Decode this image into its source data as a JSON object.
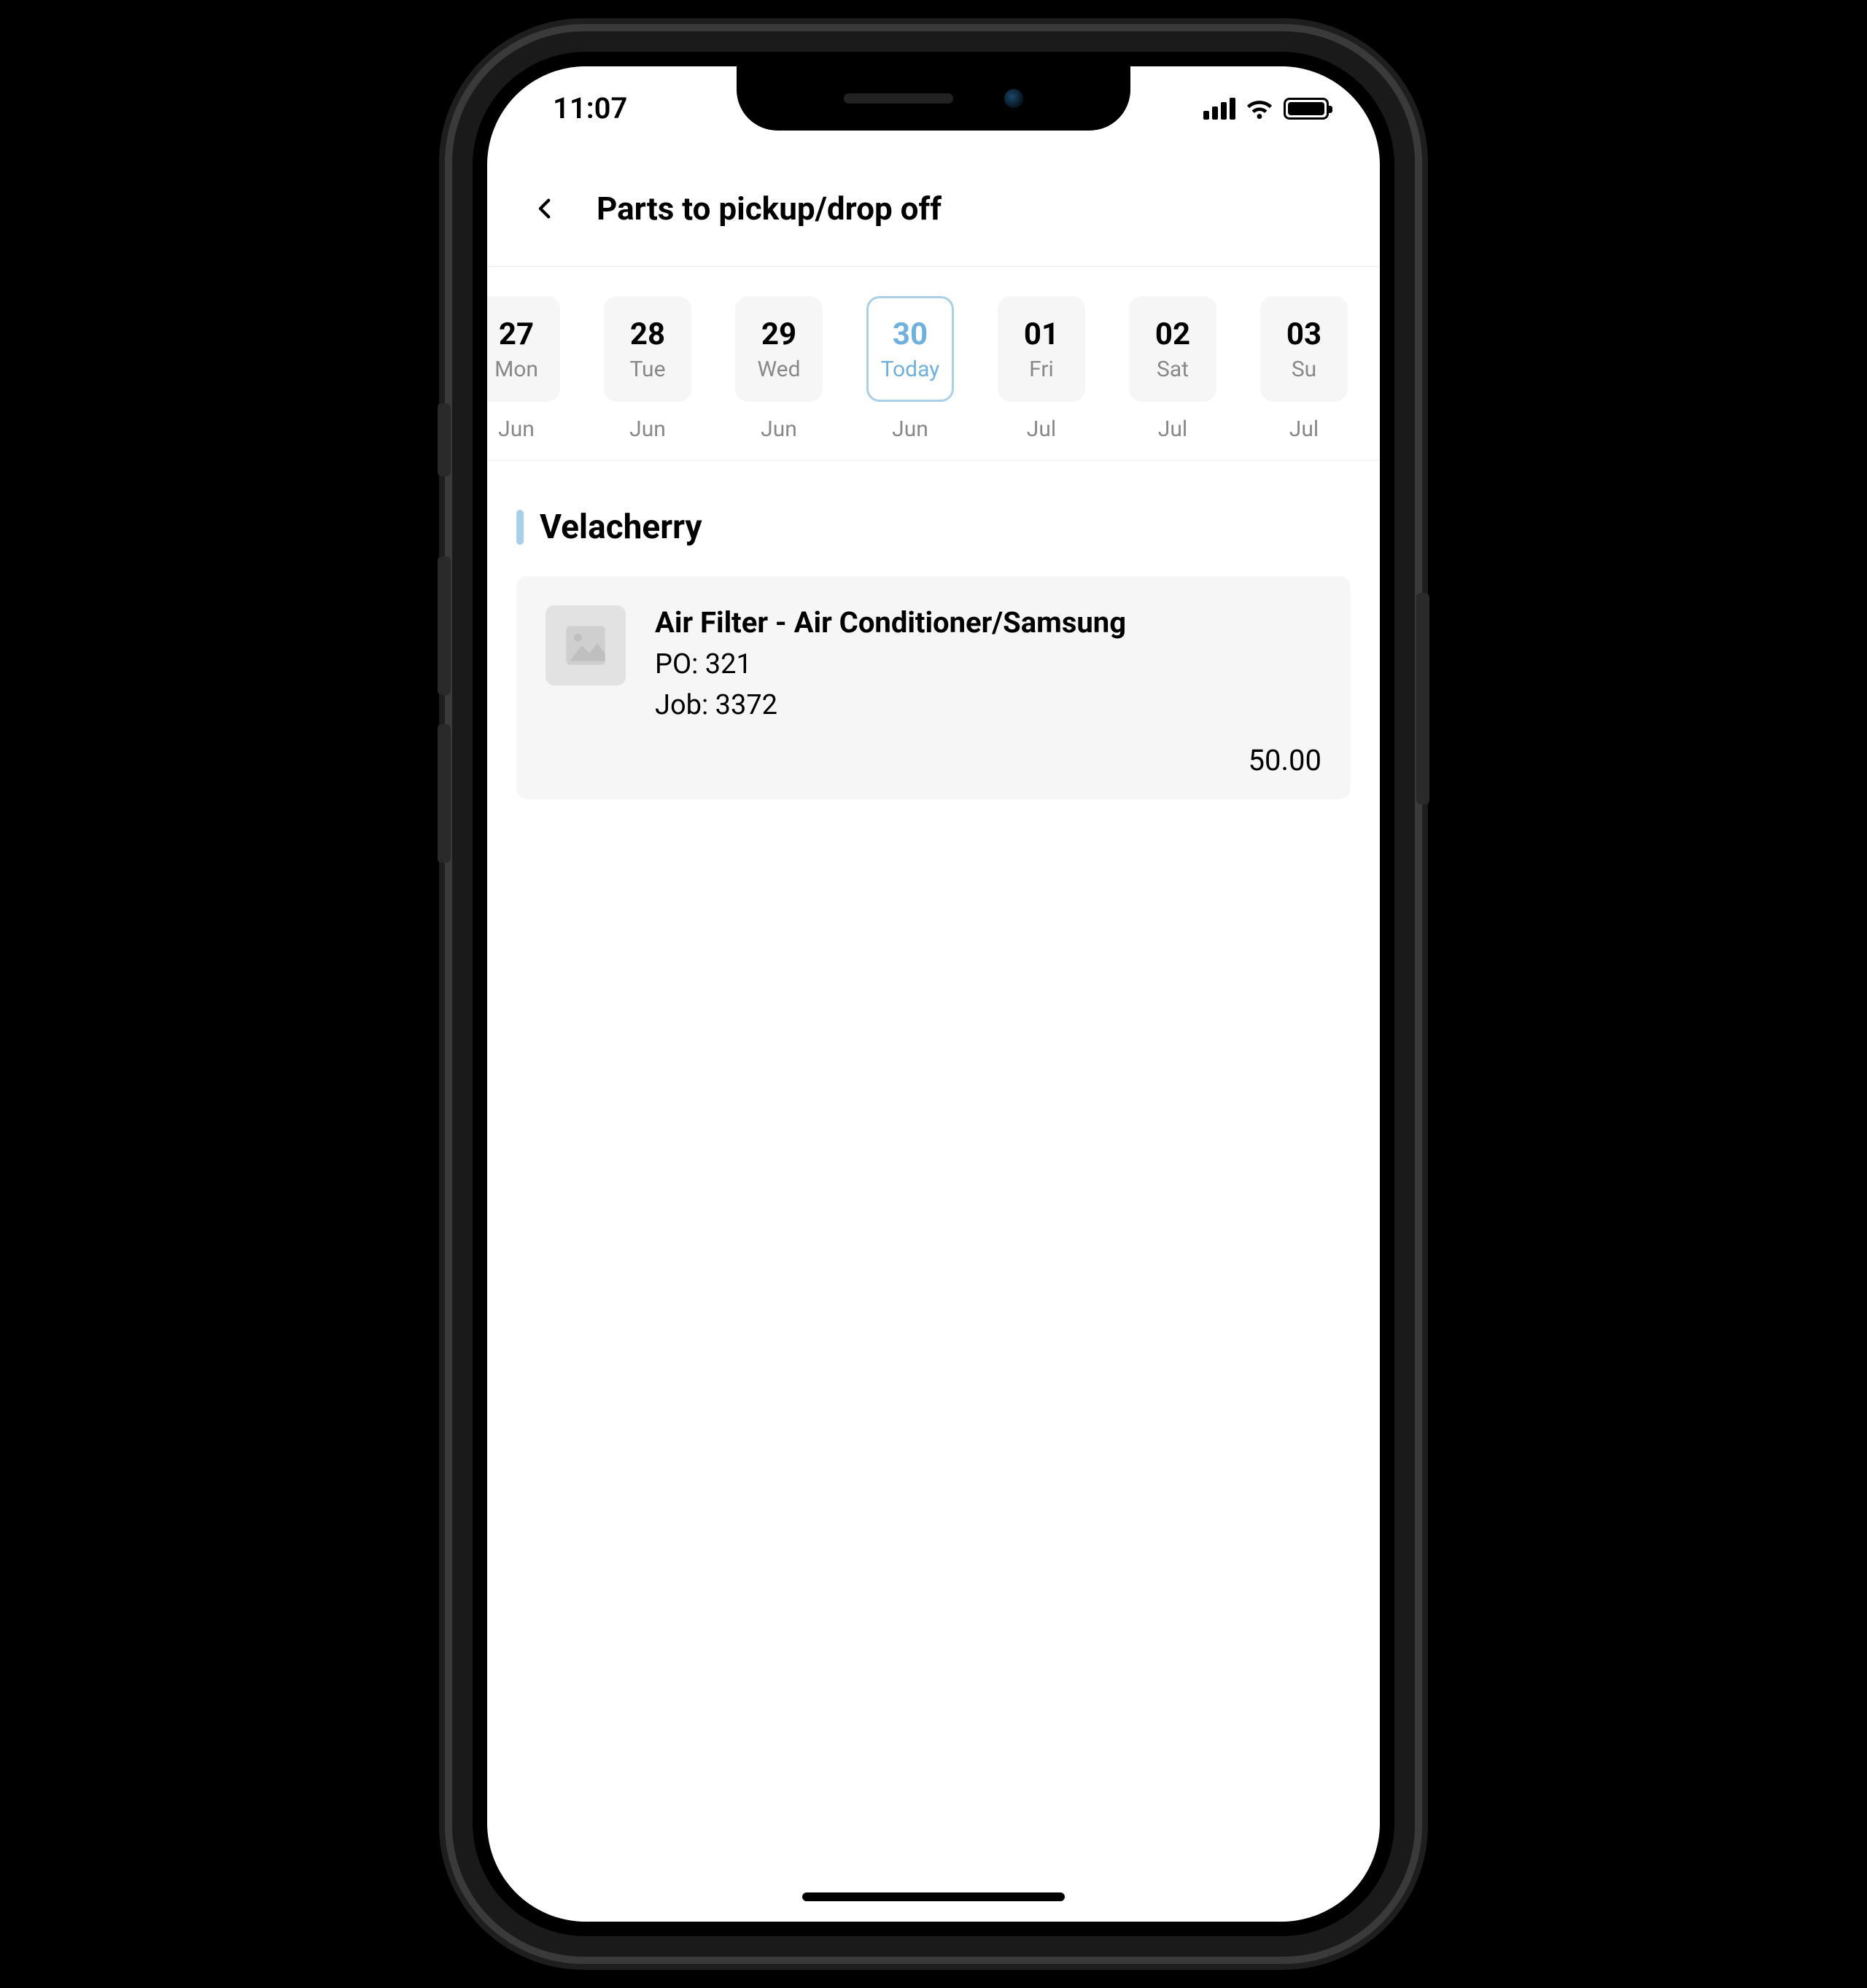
{
  "status": {
    "time": "11:07"
  },
  "header": {
    "title": "Parts to pickup/drop off"
  },
  "dates": [
    {
      "num": "27",
      "dow": "Mon",
      "month": "Jun",
      "selected": false
    },
    {
      "num": "28",
      "dow": "Tue",
      "month": "Jun",
      "selected": false
    },
    {
      "num": "29",
      "dow": "Wed",
      "month": "Jun",
      "selected": false
    },
    {
      "num": "30",
      "dow": "Today",
      "month": "Jun",
      "selected": true
    },
    {
      "num": "01",
      "dow": "Fri",
      "month": "Jul",
      "selected": false
    },
    {
      "num": "02",
      "dow": "Sat",
      "month": "Jul",
      "selected": false
    },
    {
      "num": "03",
      "dow": "Su",
      "month": "Jul",
      "selected": false
    }
  ],
  "section": {
    "title": "Velacherry"
  },
  "item": {
    "title": "Air Filter - Air Conditioner/Samsung",
    "po_label": "PO: 321",
    "job_label": "Job: 3372",
    "amount": "50.00"
  }
}
